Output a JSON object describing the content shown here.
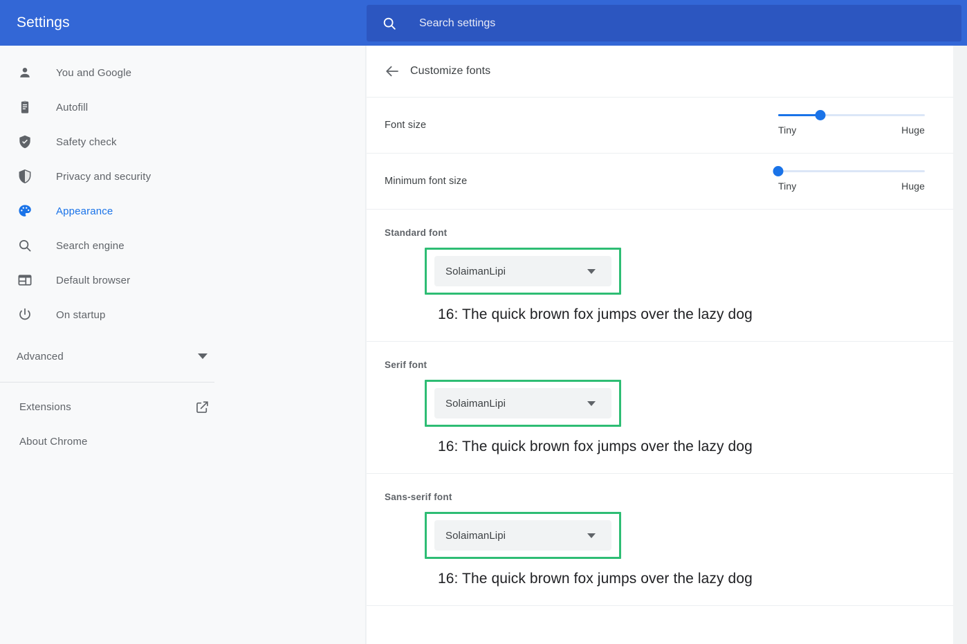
{
  "header": {
    "title": "Settings",
    "search_icon": "search-icon",
    "search_placeholder": "Search settings",
    "search_value": "",
    "bar_color": "#3367d6",
    "search_box_color": "#2c56c0"
  },
  "sidebar": {
    "items": [
      {
        "label": "You and Google",
        "icon": "person-icon",
        "selected": false
      },
      {
        "label": "Autofill",
        "icon": "clipboard-icon",
        "selected": false
      },
      {
        "label": "Safety check",
        "icon": "shield-check-icon",
        "selected": false
      },
      {
        "label": "Privacy and security",
        "icon": "shield-icon",
        "selected": false
      },
      {
        "label": "Appearance",
        "icon": "palette-icon",
        "selected": true
      },
      {
        "label": "Search engine",
        "icon": "search-icon",
        "selected": false
      },
      {
        "label": "Default browser",
        "icon": "browser-window-icon",
        "selected": false
      },
      {
        "label": "On startup",
        "icon": "power-icon",
        "selected": false
      }
    ],
    "advanced": {
      "label": "Advanced",
      "icon": "chevron-down-icon"
    },
    "bottom_items": [
      {
        "label": "Extensions",
        "icon": "open-in-new-icon"
      },
      {
        "label": "About Chrome",
        "icon": ""
      }
    ],
    "selected_color": "#1a73e8",
    "background": "#f8f9fa"
  },
  "page": {
    "back_icon": "arrow-left-icon",
    "title": "Customize fonts"
  },
  "sliders": [
    {
      "label": "Font size",
      "min_label": "Tiny",
      "max_label": "Huge",
      "value_percent": 29
    },
    {
      "label": "Minimum font size",
      "min_label": "Tiny",
      "max_label": "Huge",
      "value_percent": 0
    }
  ],
  "font_sections": [
    {
      "label": "Standard font",
      "selected_font": "SolaimanLipi",
      "dropdown_icon": "chevron-down-icon",
      "sample": "16: The quick brown fox jumps over the lazy dog",
      "highlight_color": "#2ebd74"
    },
    {
      "label": "Serif font",
      "selected_font": "SolaimanLipi",
      "dropdown_icon": "chevron-down-icon",
      "sample": "16: The quick brown fox jumps over the lazy dog",
      "highlight_color": "#2ebd74"
    },
    {
      "label": "Sans-serif font",
      "selected_font": "SolaimanLipi",
      "dropdown_icon": "chevron-down-icon",
      "sample": "16: The quick brown fox jumps over the lazy dog",
      "highlight_color": "#2ebd74"
    }
  ]
}
